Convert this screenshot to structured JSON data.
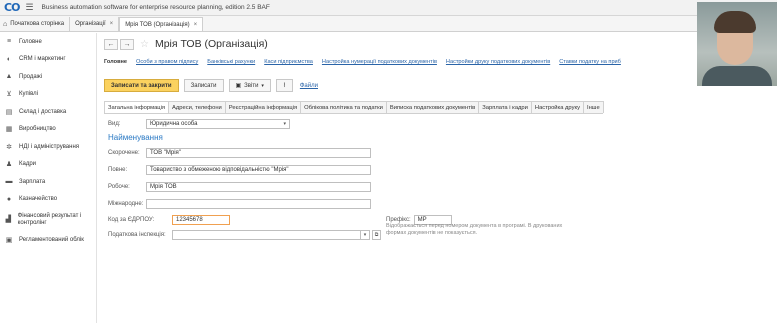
{
  "app": {
    "title": "Business automation software for enterprise resource planning, edition 2.5 BAF"
  },
  "window_tabs": [
    {
      "label": "Початкова сторінка"
    },
    {
      "label": "Організації"
    },
    {
      "label": "Мрія ТОВ (Організація)"
    }
  ],
  "sidebar": {
    "items": [
      {
        "label": "Головне",
        "icon": "menu-icon"
      },
      {
        "label": "CRM і маркетинг",
        "icon": "crm-icon"
      },
      {
        "label": "Продажі",
        "icon": "sales-icon"
      },
      {
        "label": "Купівлі",
        "icon": "cart-icon"
      },
      {
        "label": "Склад і доставка",
        "icon": "warehouse-icon"
      },
      {
        "label": "Виробництво",
        "icon": "production-icon"
      },
      {
        "label": "НДІ і адміністрування",
        "icon": "gear-icon"
      },
      {
        "label": "Кадри",
        "icon": "person-icon"
      },
      {
        "label": "Зарплата",
        "icon": "money-icon"
      },
      {
        "label": "Казначейство",
        "icon": "treasury-icon"
      },
      {
        "label": "Фінансовий результат і контролінг",
        "icon": "chart-icon"
      },
      {
        "label": "Регламентований облік",
        "icon": "ledger-icon"
      }
    ]
  },
  "document": {
    "title": "Мрія ТОВ (Організація)"
  },
  "links": [
    {
      "label": "Головне"
    },
    {
      "label": "Особи з правом підпису"
    },
    {
      "label": "Банківські рахунки"
    },
    {
      "label": "Каси підприємства"
    },
    {
      "label": "Настройка нумерації податкових документів"
    },
    {
      "label": "Настройки друку податкових документів"
    },
    {
      "label": "Ставки податку на приб"
    }
  ],
  "toolbar": {
    "save_close": "Записати та закрити",
    "save": "Записати",
    "reports": "Звіти",
    "files": "Файли"
  },
  "page_tabs": [
    {
      "label": "Загальна інформація"
    },
    {
      "label": "Адреси, телефони"
    },
    {
      "label": "Реєстраційна інформація"
    },
    {
      "label": "Облікова політика та податки"
    },
    {
      "label": "Виписка податкових документів"
    },
    {
      "label": "Зарплата і кадри"
    },
    {
      "label": "Настройка друку"
    },
    {
      "label": "Інше"
    }
  ],
  "form": {
    "type_label": "Вид:",
    "type_value": "Юридична особа",
    "section_title": "Найменування",
    "short_label": "Скорочене:",
    "short_value": "ТОВ \"Мрія\"",
    "full_label": "Повне:",
    "full_value": "Товариство з обмеженою відповідальністю \"Мрія\"",
    "work_label": "Робоче:",
    "work_value": "Мрія ТОВ",
    "intl_label": "Міжнародне:",
    "intl_value": "",
    "edrpou_label": "Код за ЄДРПОУ:",
    "edrpou_value": "12345678",
    "prefix_label": "Префікс:",
    "prefix_value": "МР",
    "tax_label": "Податкова інспекція:",
    "tax_value": "",
    "prefix_note": "Відображається перед номером документа в програмі. В друкованих формах документів не показується."
  }
}
